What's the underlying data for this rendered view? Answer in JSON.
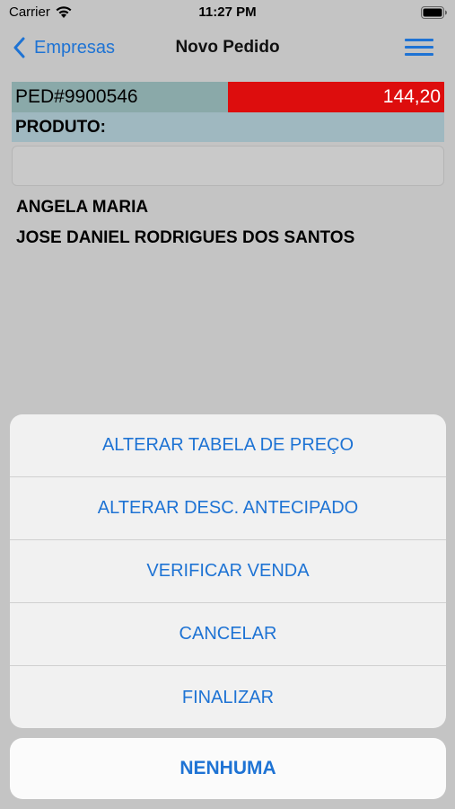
{
  "status_bar": {
    "carrier": "Carrier",
    "time": "11:27 PM",
    "icons": [
      "wifi-icon",
      "battery-icon"
    ]
  },
  "nav": {
    "back_label": "Empresas",
    "title": "Novo Pedido",
    "icons": [
      "chevron-left-icon",
      "hamburger-menu-icon"
    ]
  },
  "order": {
    "id": "PED#9900546",
    "total": "144,20",
    "product_label": "PRODUTO:",
    "product_value": ""
  },
  "clients": [
    "ANGELA MARIA",
    "JOSE DANIEL RODRIGUES DOS SANTOS"
  ],
  "action_sheet": {
    "options": [
      "ALTERAR TABELA DE PREÇO",
      "ALTERAR DESC. ANTECIPADO",
      "VERIFICAR VENDA",
      "CANCELAR",
      "FINALIZAR"
    ],
    "cancel_label": "NENHUMA"
  },
  "colors": {
    "accent": "#1e73d4",
    "total_bg": "#dd0d0d",
    "order_id_bg": "#8aa9a9",
    "product_bg": "#9fb8c0"
  }
}
